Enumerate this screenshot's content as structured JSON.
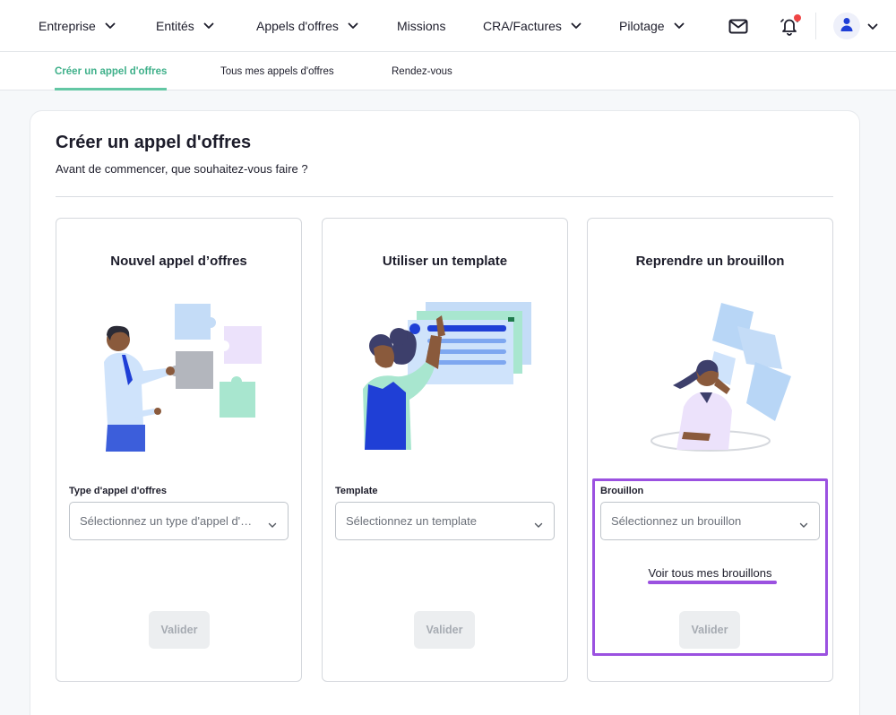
{
  "nav": {
    "items": [
      {
        "label": "Entreprise",
        "has_dropdown": true
      },
      {
        "label": "Entités",
        "has_dropdown": true
      },
      {
        "label": "Appels d'offres",
        "has_dropdown": true
      },
      {
        "label": "Missions",
        "has_dropdown": false
      },
      {
        "label": "CRA/Factures",
        "has_dropdown": true
      },
      {
        "label": "Pilotage",
        "has_dropdown": true
      }
    ],
    "icons": [
      "mail-icon",
      "bell-icon",
      "user-icon"
    ]
  },
  "subtabs": [
    {
      "label": "Créer un appel d'offres",
      "active": true
    },
    {
      "label": "Tous mes appels d'offres",
      "active": false
    },
    {
      "label": "Rendez-vous",
      "active": false
    }
  ],
  "page": {
    "title": "Créer un appel d'offres",
    "subtitle": "Avant de commencer, que souhaitez-vous faire ?"
  },
  "cards": [
    {
      "title": "Nouvel appel d’offres",
      "field_label": "Type d'appel d'offres",
      "placeholder": "Sélectionnez un type d'appel d'offres",
      "button": "Valider"
    },
    {
      "title": "Utiliser un template",
      "field_label": "Template",
      "placeholder": "Sélectionnez un template",
      "button": "Valider"
    },
    {
      "title": "Reprendre un brouillon",
      "field_label": "Brouillon",
      "placeholder": "Sélectionnez un brouillon",
      "link": "Voir tous mes brouillons",
      "button": "Valider"
    }
  ],
  "colors": {
    "accent_green": "#63c7a4",
    "highlight_purple": "#9b51e0",
    "notification_red": "#ef4444",
    "avatar_blue": "#1f3fd6"
  }
}
